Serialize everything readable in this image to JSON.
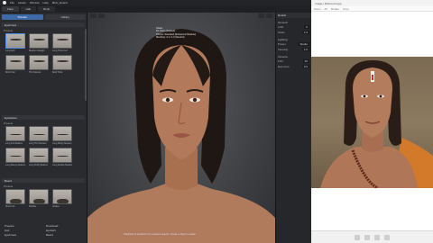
{
  "topbar": {
    "menus": [
      "File",
      "Assets",
      "Window",
      "Help"
    ],
    "title": "MHC_Export"
  },
  "tabs": [
    "Face",
    "Hair",
    "Body"
  ],
  "left_panel": {
    "toolbar": [
      "Presets",
      "Library"
    ],
    "sections": [
      {
        "title": "Eyebrows",
        "subtitle": "Presets",
        "items": [
          "Long Arch",
          "Medium Straight",
          "Long Thick Curl",
          "Short Flat",
          "Thin Natural",
          "Bold Thick"
        ]
      },
      {
        "title": "Eyelashes",
        "subtitle": "Presets",
        "items": [
          "Long Full Medium",
          "Long Thin Medium",
          "Long Wispy Medium",
          "Long Messy Medium",
          "Long Fluffy Medium",
          "Long Double Medium"
        ]
      },
      {
        "title": "Beard",
        "subtitle": "Presets",
        "items": [
          "Short Full",
          "Stubble",
          "Goatee"
        ]
      }
    ],
    "bottom": [
      [
        "Prepare",
        "Download"
      ],
      [
        "Hair",
        "Eyelash"
      ],
      [
        "Eyebrows",
        "Beard"
      ]
    ]
  },
  "viewport": {
    "info_lines": [
      "Status",
      "Fit: None (Default)",
      "Picture: Standard (Enhanced Shadow)",
      "Meshing: 4.1 / 1.0 (Neutral)"
    ],
    "caption": "Playback & workflow for unsaved assets. Create a flag to enable."
  },
  "right_panel": {
    "title": "Details",
    "sections": [
      {
        "name": "General",
        "rows": [
          [
            "LOD",
            "0"
          ],
          [
            "Scale",
            "1.0"
          ]
        ]
      },
      {
        "name": "Lighting",
        "rows": [
          [
            "Preset",
            "Studio"
          ],
          [
            "Intensity",
            "1.0"
          ]
        ]
      },
      {
        "name": "Camera",
        "rows": [
          [
            "FOV",
            "45"
          ],
          [
            "Exposure",
            "0.0"
          ]
        ]
      }
    ]
  },
  "photo_window": {
    "title": "Image | Reference.jpg",
    "toolbar": [
      "Zoom",
      "Fit",
      "Rotate",
      "Crop"
    ]
  }
}
